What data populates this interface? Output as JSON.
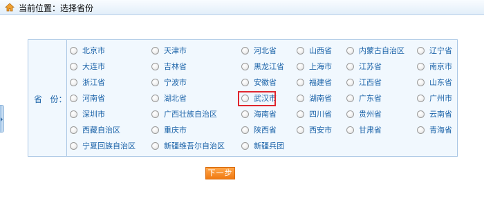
{
  "header": {
    "title": "当前位置：选择省份",
    "icon": "home-icon"
  },
  "form": {
    "label": "省   份：",
    "rows": [
      [
        "北京市",
        "天津市",
        "河北省",
        "山西省",
        "内蒙古自治区",
        "辽宁省"
      ],
      [
        "大连市",
        "吉林省",
        "黑龙江省",
        "上海市",
        "江苏省",
        "南京市"
      ],
      [
        "浙江省",
        "宁波市",
        "安徽省",
        "福建省",
        "江西省",
        "山东省"
      ],
      [
        "河南省",
        "湖北省",
        "武汉市",
        "湖南省",
        "广东省",
        "广州市"
      ],
      [
        "深圳市",
        "广西壮族自治区",
        "海南省",
        "四川省",
        "贵州省",
        "云南省"
      ],
      [
        "西藏自治区",
        "重庆市",
        "陕西省",
        "西安市",
        "甘肃省",
        "青海省"
      ],
      [
        "宁夏回族自治区",
        "新疆维吾尔自治区",
        "新疆兵团"
      ]
    ],
    "highlighted": "武汉市",
    "highlight_color": "#e0262e"
  },
  "next_button": {
    "label": "下一步",
    "color": "#f58a20"
  }
}
